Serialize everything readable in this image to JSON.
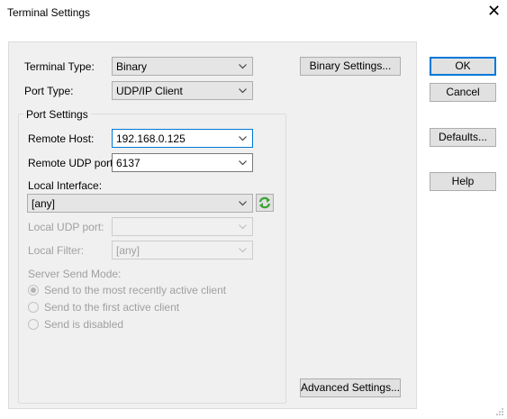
{
  "window": {
    "title": "Terminal Settings"
  },
  "fields": {
    "terminal_type": {
      "label": "Terminal Type:",
      "value": "Binary"
    },
    "port_type": {
      "label": "Port Type:",
      "value": "UDP/IP Client"
    },
    "port_settings": {
      "label": "Port Settings"
    },
    "remote_host": {
      "label": "Remote Host:",
      "value": "192.168.0.125"
    },
    "remote_udp_port": {
      "label": "Remote UDP port:",
      "value": "6137"
    },
    "local_interface": {
      "label": "Local Interface:",
      "value": "[any]"
    },
    "local_udp_port": {
      "label": "Local UDP port:",
      "value": ""
    },
    "local_filter": {
      "label": "Local Filter:",
      "value": "[any]"
    },
    "server_send_mode": {
      "label": "Server Send Mode:",
      "options": [
        "Send to the most recently active client",
        "Send to the first active client",
        "Send is disabled"
      ],
      "selected_index": 0
    }
  },
  "buttons": {
    "binary_settings": "Binary Settings...",
    "advanced_settings": "Advanced Settings...",
    "ok": "OK",
    "cancel": "Cancel",
    "defaults": "Defaults...",
    "help": "Help"
  },
  "colors": {
    "focus_accent": "#0078d7",
    "dialog_bg": "#f0f0f0",
    "refresh_icon": "#3aa335"
  }
}
